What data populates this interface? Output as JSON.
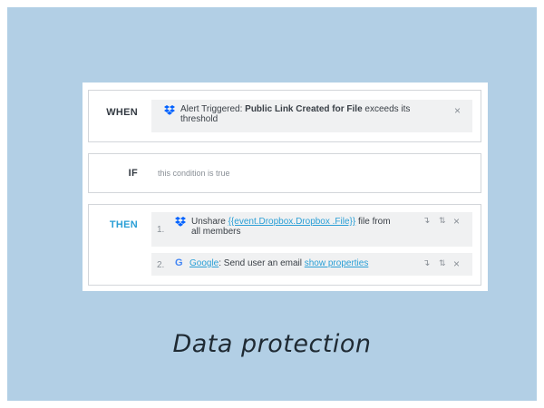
{
  "rule": {
    "when": {
      "label": "WHEN",
      "trigger_prefix": "Alert Triggered: ",
      "trigger_bold": "Public Link Created for File",
      "trigger_suffix_line1": " exceeds its",
      "trigger_suffix_line2": "threshold",
      "icon": "dropbox-icon",
      "remove": "×"
    },
    "if": {
      "label": "IF",
      "condition": "this condition is true"
    },
    "then": {
      "label": "THEN",
      "actions": [
        {
          "number": "1.",
          "icon": "dropbox-icon",
          "text_prefix": "Unshare ",
          "link": "{{event.Dropbox.Dropbox .File}}",
          "text_suffix_line1": " file from",
          "text_suffix_line2": "all members",
          "controls": [
            "↴",
            "⇅",
            "×"
          ]
        },
        {
          "number": "2.",
          "icon": "google-icon",
          "icon_glyph": "G",
          "service": "Google",
          "text": ": Send user an email ",
          "link": "show properties",
          "controls": [
            "↴",
            "⇅",
            "×"
          ]
        }
      ]
    }
  },
  "caption": "Data protection",
  "colors": {
    "background": "#b2cfe5",
    "accent": "#2a9fd6",
    "dropbox": "#0061ff",
    "google": "#4285f4"
  }
}
